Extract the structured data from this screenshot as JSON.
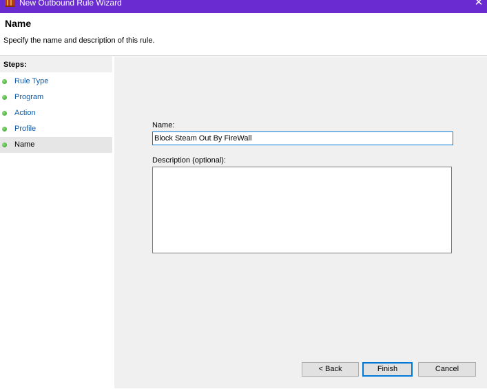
{
  "window": {
    "title": "New Outbound Rule Wizard",
    "close_label": "✕",
    "icon": "firewall-wall-icon"
  },
  "header": {
    "title": "Name",
    "subtitle": "Specify the name and description of this rule."
  },
  "steps": {
    "heading": "Steps:",
    "items": [
      {
        "label": "Rule Type",
        "state": "completed"
      },
      {
        "label": "Program",
        "state": "completed"
      },
      {
        "label": "Action",
        "state": "completed"
      },
      {
        "label": "Profile",
        "state": "completed"
      },
      {
        "label": "Name",
        "state": "current"
      }
    ]
  },
  "form": {
    "name_label": "Name:",
    "name_value": "Block Steam Out By FireWall",
    "description_label": "Description (optional):",
    "description_value": ""
  },
  "buttons": {
    "back": "< Back",
    "finish": "Finish",
    "cancel": "Cancel"
  },
  "colors": {
    "titlebar": "#6a2bd0",
    "link": "#0b5aa8",
    "focus_border": "#0078d7",
    "step_dot": "#2f9d26"
  }
}
